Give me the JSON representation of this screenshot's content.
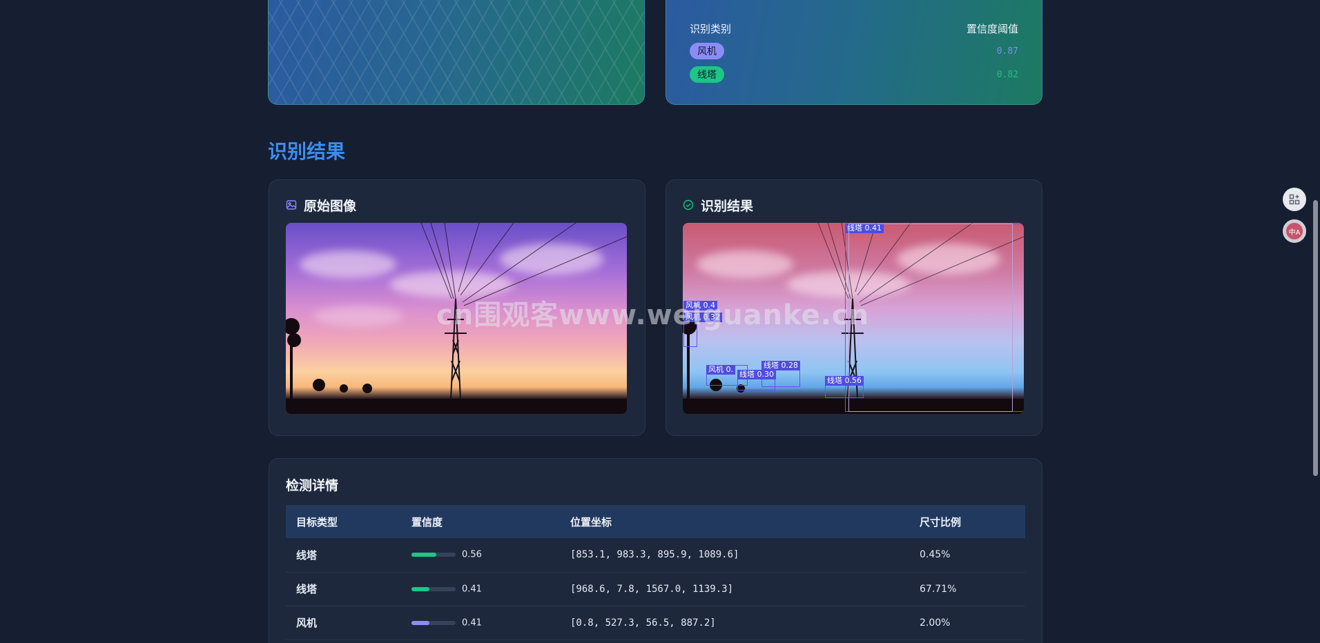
{
  "threshold_panel": {
    "col_class": "识别类别",
    "col_threshold": "置信度阈值",
    "rows": [
      {
        "label": "风机",
        "value": "0.87"
      },
      {
        "label": "线塔",
        "value": "0.82"
      }
    ]
  },
  "results": {
    "section_title": "识别结果",
    "original_title": "原始图像",
    "result_title": "识别结果",
    "boxes": [
      {
        "label": "线塔 0.41"
      },
      {
        "label": "风机 0.4"
      },
      {
        "label": "风机 0.32"
      },
      {
        "label": "风机 0."
      },
      {
        "label": "线塔 0.28"
      },
      {
        "label": "线塔 0.30"
      },
      {
        "label": "线塔 0.56"
      }
    ]
  },
  "watermark": "cn围观客www.weiguanke.cn",
  "detail": {
    "title": "检测详情",
    "headers": [
      "目标类型",
      "置信度",
      "位置坐标",
      "尺寸比例"
    ],
    "rows": [
      {
        "type": "线塔",
        "confidence": 0.56,
        "confidence_text": "0.56",
        "coords": "[853.1, 983.3, 895.9, 1089.6]",
        "ratio": "0.45%"
      },
      {
        "type": "线塔",
        "confidence": 0.41,
        "confidence_text": "0.41",
        "coords": "[968.6, 7.8, 1567.0, 1139.3]",
        "ratio": "67.71%"
      },
      {
        "type": "风机",
        "confidence": 0.41,
        "confidence_text": "0.41",
        "coords": "[0.8, 527.3, 56.5, 887.2]",
        "ratio": "2.00%"
      }
    ]
  },
  "colors": {
    "accent": "#3b8ef0",
    "tower": "#1cc685",
    "fan": "#8d8cf6"
  },
  "icons": [
    "image-icon",
    "check-circle-icon",
    "apps-add-icon",
    "translate-icon"
  ]
}
